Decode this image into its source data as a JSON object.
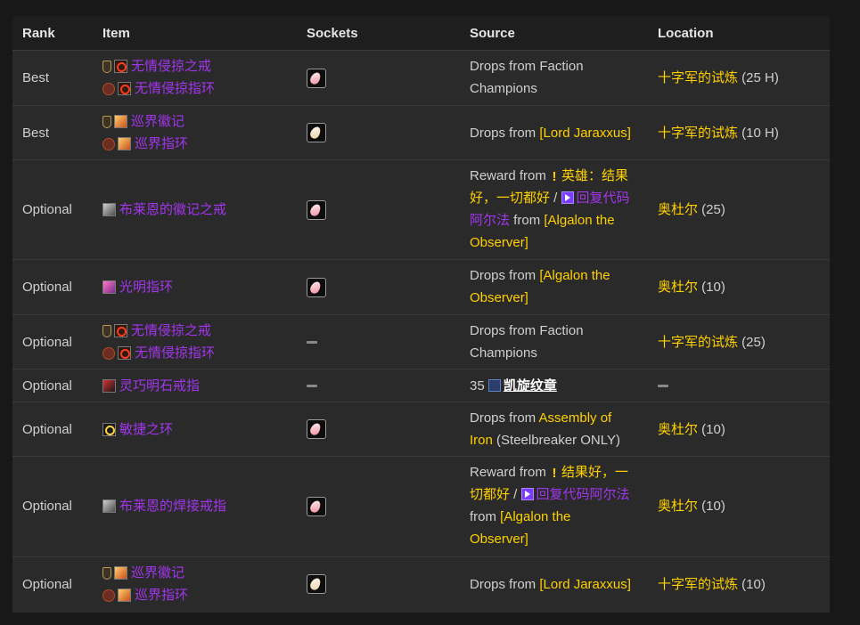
{
  "headers": {
    "rank": "Rank",
    "item": "Item",
    "sockets": "Sockets",
    "source": "Source",
    "location": "Location"
  },
  "colors": {
    "epic": "#a335ee",
    "link": "#ffd100",
    "text": "#d0d0d0",
    "panel": "#2a2a2a"
  },
  "rows": [
    {
      "rank": "Best",
      "items": [
        {
          "icon": "shield-slot-icon",
          "name": "无情侵掠之戒"
        },
        {
          "icon": "horde-slot-icon",
          "name": "无情侵掠指环"
        }
      ],
      "socket": "red-gem-socket",
      "source": {
        "pre": "Drops from Faction",
        "post": "Champions"
      },
      "location": {
        "name": "十字军的试炼",
        "suffix": " (25 H)"
      }
    },
    {
      "rank": "Best",
      "items": [
        {
          "icon": "shield-slot-icon",
          "name": "巡界徽记"
        },
        {
          "icon": "horde-slot-icon",
          "name": "巡界指环"
        }
      ],
      "socket": "pale-gem-socket",
      "source": {
        "pre": "Drops from ",
        "link": "[Lord Jaraxxus]"
      },
      "location": {
        "name": "十字军的试炼",
        "suffix": " (10 H)"
      }
    },
    {
      "rank": "Optional",
      "items": [
        {
          "name": "布莱恩的徽记之戒"
        }
      ],
      "socket": "red-gem-socket",
      "source": {
        "l1a": "Reward from ",
        "l1b": "英雄：结果",
        "l2a": "好，一切都好",
        "l2b": " / ",
        "l2c": "回复代码",
        "l3a": "阿尔法",
        "l3b": " from ",
        "l3c": "[Algalon the",
        "l4": "Observer]"
      },
      "location": {
        "name": "奥杜尔",
        "suffix": " (25)"
      }
    },
    {
      "rank": "Optional",
      "items": [
        {
          "name": "光明指环"
        }
      ],
      "socket": "red-gem-socket",
      "source": {
        "pre": "Drops from ",
        "link": "[Algalon the",
        "line2": "Observer]"
      },
      "location": {
        "name": "奥杜尔",
        "suffix": " (10)"
      }
    },
    {
      "rank": "Optional",
      "items": [
        {
          "icon": "shield-slot-icon",
          "name": "无情侵掠之戒"
        },
        {
          "icon": "horde-slot-icon",
          "name": "无情侵掠指环"
        }
      ],
      "socket": "none",
      "source": {
        "pre": "Drops from Faction",
        "post": "Champions"
      },
      "location": {
        "name": "十字军的试炼",
        "suffix": " (25)"
      }
    },
    {
      "rank": "Optional",
      "items": [
        {
          "name": "灵巧明石戒指"
        }
      ],
      "socket": "none",
      "source": {
        "count": "35",
        "token": "凯旋纹章"
      },
      "location": {
        "name": "",
        "suffix": ""
      }
    },
    {
      "rank": "Optional",
      "items": [
        {
          "name": "敏捷之环"
        }
      ],
      "socket": "red-gem-socket",
      "source": {
        "pre": "Drops from ",
        "link": "Assembly of",
        "link2": "Iron",
        "post": " (Steelbreaker ONLY)"
      },
      "location": {
        "name": "奥杜尔",
        "suffix": " (10)"
      }
    },
    {
      "rank": "Optional",
      "items": [
        {
          "name": "布莱恩的焊接戒指"
        }
      ],
      "socket": "red-gem-socket",
      "source": {
        "l1a": "Reward from ",
        "l1b": "结果好，一",
        "l2a": "切都好",
        "l2b": " / ",
        "l2c": "回复代码阿尔法",
        "l3a": "from ",
        "l3b": "[Algalon the",
        "l4": "Observer]"
      },
      "location": {
        "name": "奥杜尔",
        "suffix": " (10)"
      }
    },
    {
      "rank": "Optional",
      "items": [
        {
          "icon": "shield-slot-icon",
          "name": "巡界徽记"
        },
        {
          "icon": "horde-slot-icon",
          "name": "巡界指环"
        }
      ],
      "socket": "pale-gem-socket",
      "source": {
        "pre": "Drops from ",
        "link": "[Lord Jaraxxus]"
      },
      "location": {
        "name": "十字军的试炼",
        "suffix": " (10)"
      }
    }
  ]
}
